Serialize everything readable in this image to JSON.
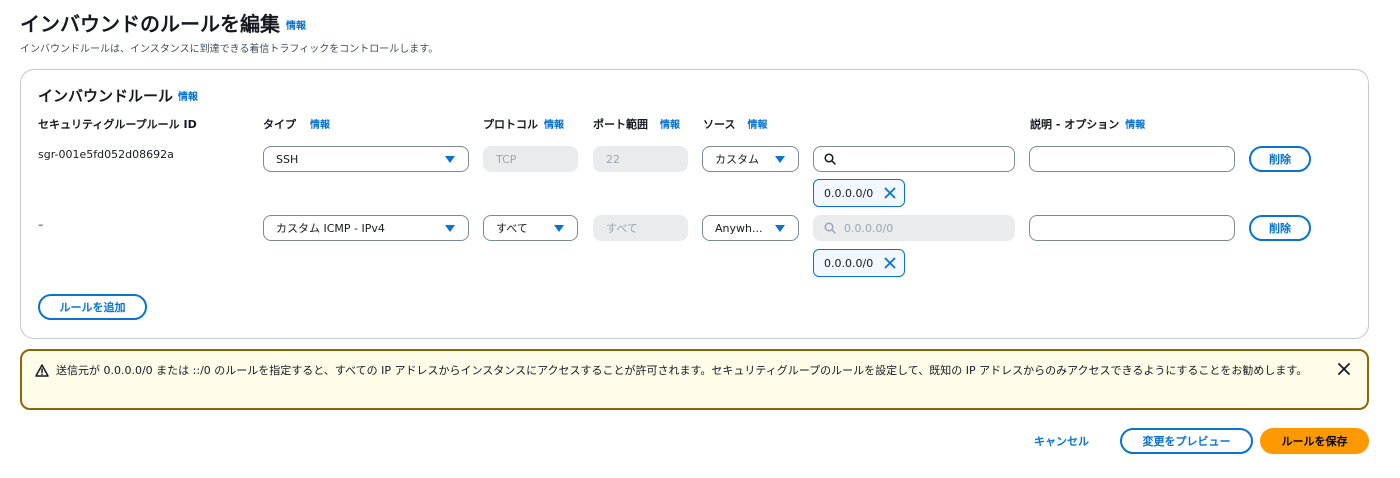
{
  "page": {
    "title": "インバウンドのルールを編集",
    "title_info": "情報",
    "description": "インバウンドルールは、インスタンスに到達できる着信トラフィックをコントロールします。"
  },
  "panel": {
    "title": "インバウンドルール",
    "title_info": "情報",
    "columns": {
      "rule_id": "セキュリティグループルール ID",
      "type": "タイプ",
      "protocol": "プロトコル",
      "port_range": "ポート範囲",
      "source": "ソース",
      "description": "説明 - オプション"
    },
    "info": "情報",
    "rows": [
      {
        "rule_id": "sgr-001e5fd052d08692a",
        "type": "SSH",
        "protocol": "TCP",
        "port_range": "22",
        "source_type": "カスタム",
        "search_value": "",
        "search_placeholder": "",
        "token": "0.0.0.0/0",
        "description_value": "",
        "delete_label": "削除"
      },
      {
        "rule_id": "–",
        "type": "カスタム ICMP - IPv4",
        "protocol": "すべて",
        "port_range": "すべて",
        "source_type": "Anywh...",
        "search_value": "",
        "search_placeholder": "0.0.0.0/0",
        "token": "0.0.0.0/0",
        "description_value": "",
        "delete_label": "削除"
      }
    ],
    "add_rule_label": "ルールを追加"
  },
  "alert": {
    "text": "送信元が 0.0.0.0/0 または ::/0 のルールを指定すると、すべての IP アドレスからインスタンスにアクセスすることが許可されます。セキュリティグループのルールを設定して、既知の IP アドレスからのみアクセスできるようにすることをお勧めします。"
  },
  "footer": {
    "cancel_label": "キャンセル",
    "preview_label": "変更をプレビュー",
    "save_label": "ルールを保存"
  },
  "colors": {
    "accent": "#0972d3",
    "primary_button": "#ff9900",
    "warning_border": "#8d6605",
    "warning_bg": "#fffce9"
  }
}
